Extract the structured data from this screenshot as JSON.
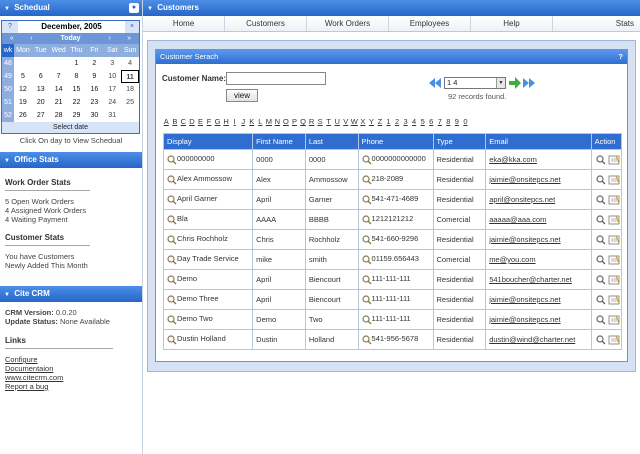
{
  "left": {
    "schedule_title": "Schedual",
    "calendar": {
      "help": "?",
      "month_label": "December, 2005",
      "close": "×",
      "nav": {
        "prev_year": "«",
        "prev_month": "‹",
        "today": "Today",
        "next_month": "›",
        "next_year": "»"
      },
      "week_header": "wk",
      "day_headers": [
        "Mon",
        "Tue",
        "Wed",
        "Thu",
        "Fri",
        "Sat",
        "Sun"
      ],
      "weeks": [
        {
          "wk": "48",
          "days": [
            "",
            "",
            "",
            "1",
            "2",
            "3",
            "4"
          ]
        },
        {
          "wk": "49",
          "days": [
            "5",
            "6",
            "7",
            "8",
            "9",
            "10",
            "11"
          ]
        },
        {
          "wk": "50",
          "days": [
            "12",
            "13",
            "14",
            "15",
            "16",
            "17",
            "18"
          ]
        },
        {
          "wk": "51",
          "days": [
            "19",
            "20",
            "21",
            "22",
            "23",
            "24",
            "25"
          ]
        },
        {
          "wk": "52",
          "days": [
            "26",
            "27",
            "28",
            "29",
            "30",
            "31",
            ""
          ]
        }
      ],
      "selected_day": "11",
      "footer": "Select date"
    },
    "calendar_note": "Click On day to View Schedual",
    "office_stats_title": "Office Stats",
    "work_order_stats_title": "Work Order Stats",
    "work_order_lines": [
      "5 Open Work Orders",
      "4 Assigned Work Orders",
      "4 Waiting Payment"
    ],
    "customer_stats_title": "Customer Stats",
    "customer_lines": [
      "You have Customers",
      "Newly Added This Month"
    ],
    "cite_crm_title": "Cite CRM",
    "crm_version_label": "CRM Version:",
    "crm_version_value": "0.0.20",
    "update_status_label": "Update Status:",
    "update_status_value": "None Available",
    "links_title": "Links",
    "links": [
      "Configure",
      "Documentaion",
      "www.citecrm.com",
      "Report a bug"
    ]
  },
  "right": {
    "header_title": "Customers",
    "tabs": [
      "Home",
      "Customers",
      "Work Orders",
      "Employees",
      "Help",
      "Stats"
    ],
    "search": {
      "title": "Customer Serach",
      "help": "?",
      "name_label": "Customer Name:",
      "name_value": "",
      "view_button": "view",
      "page_select_value": "1 4",
      "records_found": "92 records found."
    },
    "alphabet": [
      "A",
      "B",
      "C",
      "D",
      "E",
      "F",
      "G",
      "H",
      "I",
      "J",
      "K",
      "L",
      "M",
      "N",
      "O",
      "P",
      "Q",
      "R",
      "S",
      "T",
      "U",
      "V",
      "W",
      "X",
      "Y",
      "Z",
      "1",
      "2",
      "3",
      "4",
      "5",
      "6",
      "7",
      "8",
      "9",
      "0"
    ],
    "table": {
      "columns": [
        "Display",
        "First Name",
        "Last",
        "Phone",
        "Type",
        "Email",
        "Action"
      ],
      "rows": [
        [
          "000000000",
          "0000",
          "0000",
          "0000000000000",
          "Residential",
          "eka@kka.com"
        ],
        [
          "Alex Ammossow",
          "Alex",
          "Ammossow",
          "218-2089",
          "Residential",
          "jaimie@onsitepcs.net"
        ],
        [
          "April Garner",
          "April",
          "Garner",
          "541-471-4689",
          "Residential",
          "april@onsitepcs.net"
        ],
        [
          "Bla",
          "AAAA",
          "BBBB",
          "1212121212",
          "Comercial",
          "aaaaa@aaa.com"
        ],
        [
          "Chris Rochholz",
          "Chris",
          "Rochholz",
          "541-660-9296",
          "Residential",
          "jaimie@onsitepcs.net"
        ],
        [
          "Day Trade Service",
          "mike",
          "smith",
          "01159.656443",
          "Comercial",
          "me@you.com"
        ],
        [
          "Demo",
          "April",
          "Biencourt",
          "111-111-111",
          "Residential",
          "541boucher@charter.net"
        ],
        [
          "Demo Three",
          "April",
          "Biencourt",
          "111-111-111",
          "Residential",
          "jaimie@onsitepcs.net"
        ],
        [
          "Demo Two",
          "Demo",
          "Two",
          "111-111-111",
          "Residential",
          "jaimie@onsitepcs.net"
        ],
        [
          "Dustin Holland",
          "Dustin",
          "Holland",
          "541-956-5678",
          "Residential",
          "dustin@wind@charter.net"
        ]
      ]
    }
  },
  "colors": {
    "header_blue": "#2566c8",
    "table_header": "#2f6ed0",
    "content_bg": "#d6e2f4",
    "pager_blue": "#4a90e2",
    "pager_green": "#3fae3f"
  }
}
